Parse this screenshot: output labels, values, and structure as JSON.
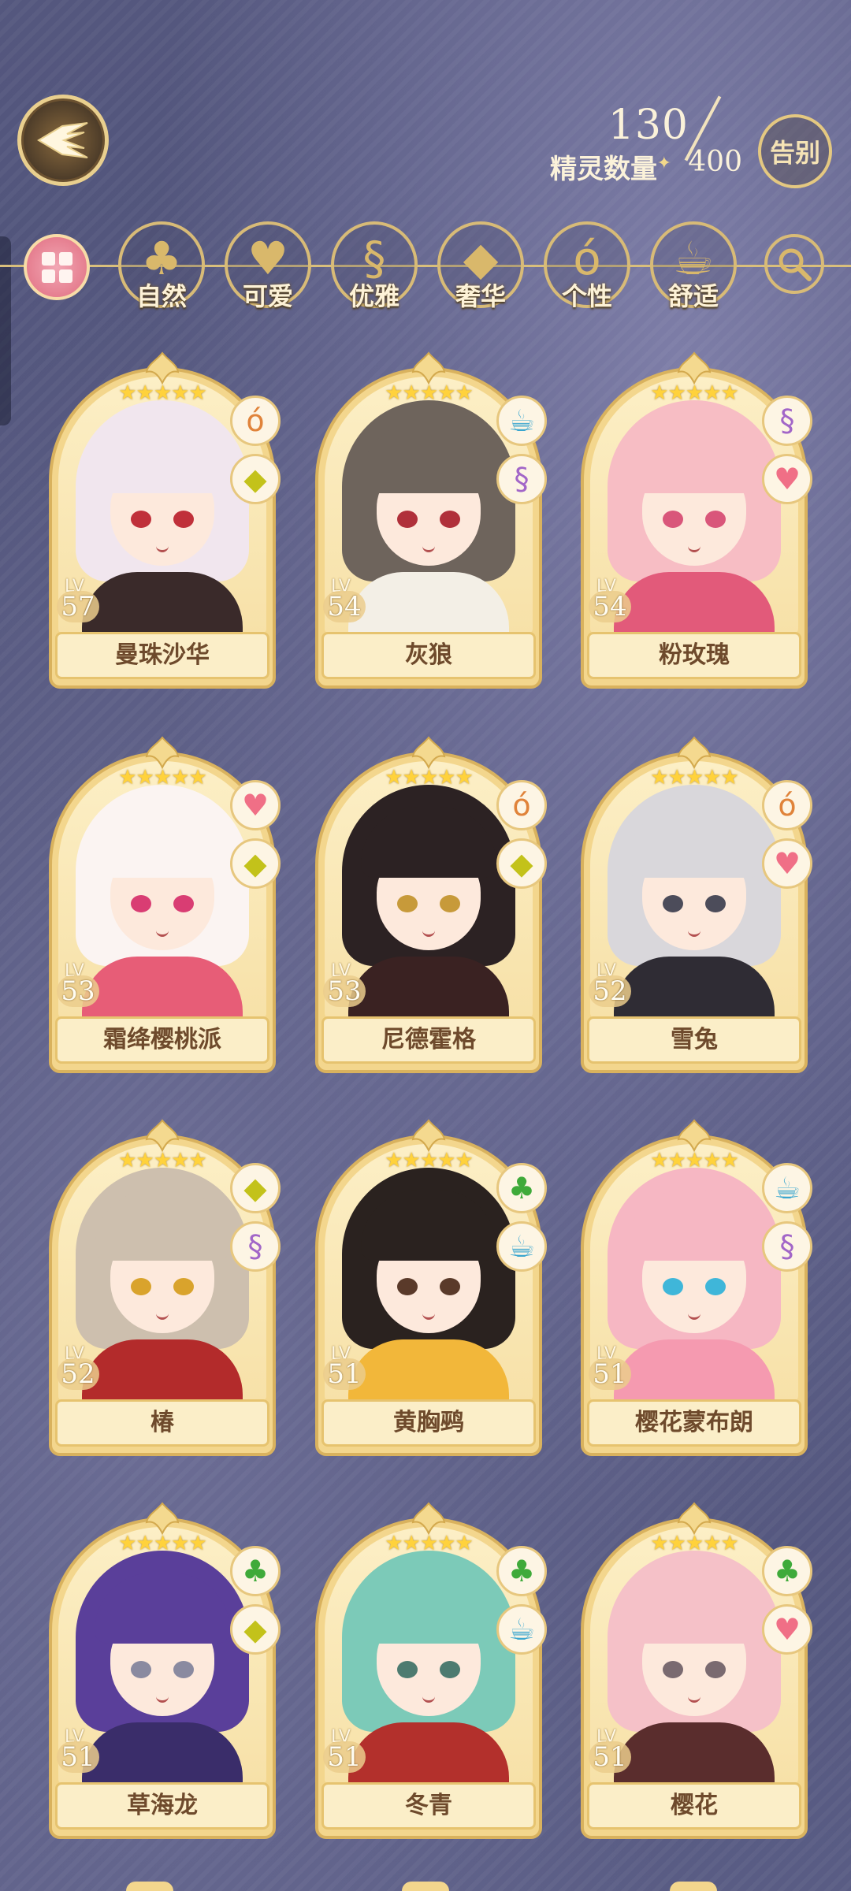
{
  "header": {
    "count_label": "精灵数量",
    "count_now": "130",
    "count_max": "400",
    "farewell_label": "告别"
  },
  "filters": [
    {
      "label": "自然",
      "icon": "clover-icon"
    },
    {
      "label": "可爱",
      "icon": "heart-icon"
    },
    {
      "label": "优雅",
      "icon": "swan-icon"
    },
    {
      "label": "奢华",
      "icon": "diamond-icon"
    },
    {
      "label": "个性",
      "icon": "glasses-icon"
    },
    {
      "label": "舒适",
      "icon": "teacup-icon"
    }
  ],
  "cards": [
    {
      "name": "曼珠沙华",
      "lv_label": "LV",
      "level": "57",
      "stars": 5,
      "attrs": [
        "glasses-icon",
        "diamond-icon"
      ],
      "hair": "#f1e6ee",
      "eyes": "#c0303a",
      "outfit": "#3a2a2a"
    },
    {
      "name": "灰狼",
      "lv_label": "LV",
      "level": "54",
      "stars": 5,
      "attrs": [
        "teacup-icon",
        "swan-icon"
      ],
      "hair": "#6e645c",
      "eyes": "#b0303a",
      "outfit": "#f3efe6"
    },
    {
      "name": "粉玫瑰",
      "lv_label": "LV",
      "level": "54",
      "stars": 5,
      "attrs": [
        "swan-icon",
        "heart-icon"
      ],
      "hair": "#f7bdc4",
      "eyes": "#d9567a",
      "outfit": "#e25a7a"
    },
    {
      "name": "霜绛樱桃派",
      "lv_label": "LV",
      "level": "53",
      "stars": 5,
      "attrs": [
        "heart-icon",
        "diamond-icon"
      ],
      "hair": "#fbf4f2",
      "eyes": "#d93d73",
      "outfit": "#e75d77"
    },
    {
      "name": "尼德霍格",
      "lv_label": "LV",
      "level": "53",
      "stars": 5,
      "attrs": [
        "glasses-icon",
        "diamond-icon"
      ],
      "hair": "#2c2223",
      "eyes": "#c79a3a",
      "outfit": "#3a2222"
    },
    {
      "name": "雪兔",
      "lv_label": "LV",
      "level": "52",
      "stars": 5,
      "attrs": [
        "glasses-icon",
        "heart-icon"
      ],
      "hair": "#d9d7db",
      "eyes": "#4c4c5a",
      "outfit": "#2f2c34"
    },
    {
      "name": "椿",
      "lv_label": "LV",
      "level": "52",
      "stars": 5,
      "attrs": [
        "diamond-icon",
        "swan-icon"
      ],
      "hair": "#cdbfae",
      "eyes": "#d9a32c",
      "outfit": "#b32b2b"
    },
    {
      "name": "黄胸鹀",
      "lv_label": "LV",
      "level": "51",
      "stars": 5,
      "attrs": [
        "clover-icon",
        "teacup-icon"
      ],
      "hair": "#2a221f",
      "eyes": "#5a3a2a",
      "outfit": "#f2b73a"
    },
    {
      "name": "樱花蒙布朗",
      "lv_label": "LV",
      "level": "51",
      "stars": 5,
      "attrs": [
        "teacup-icon",
        "swan-icon"
      ],
      "hair": "#f6b7c3",
      "eyes": "#3fb6d9",
      "outfit": "#f59ab0"
    },
    {
      "name": "草海龙",
      "lv_label": "LV",
      "level": "51",
      "stars": 5,
      "attrs": [
        "clover-icon",
        "diamond-icon"
      ],
      "hair": "#5a3f9a",
      "eyes": "#8a8aa0",
      "outfit": "#3a2d6a"
    },
    {
      "name": "冬青",
      "lv_label": "LV",
      "level": "51",
      "stars": 5,
      "attrs": [
        "clover-icon",
        "teacup-icon"
      ],
      "hair": "#7ccab8",
      "eyes": "#4d7b70",
      "outfit": "#b3302c"
    },
    {
      "name": "樱花",
      "lv_label": "LV",
      "level": "51",
      "stars": 5,
      "attrs": [
        "clover-icon",
        "heart-icon"
      ],
      "hair": "#f5c1c8",
      "eyes": "#7a6a70",
      "outfit": "#5a2d2d"
    }
  ],
  "icon_glyphs": {
    "clover-icon": "♣",
    "heart-icon": "♥",
    "swan-icon": "§",
    "diamond-icon": "◆",
    "glasses-icon": "ó",
    "teacup-icon": "☕"
  },
  "icon_colors": {
    "clover-icon": "#3faa3a",
    "heart-icon": "#f06f86",
    "swan-icon": "#a266c8",
    "diamond-icon": "#c3c21a",
    "glasses-icon": "#e0833a",
    "teacup-icon": "#3aa6cf"
  },
  "colors": {
    "gold": "#d9b25e",
    "card_bg": "#f3d68d",
    "name_text": "#6e4a2c",
    "star": "#ffd23c"
  }
}
